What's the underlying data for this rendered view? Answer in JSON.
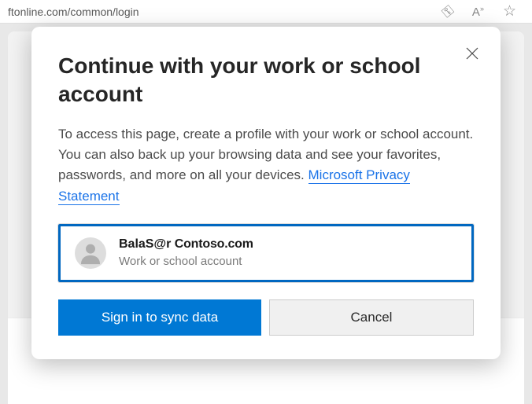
{
  "url_bar": {
    "text": "ftonline.com/common/login"
  },
  "dialog": {
    "title": "Continue with your work or school account",
    "body_text": "To access this page, create a profile with your work or school account. You can also back up your browsing data and see your favorites, passwords, and more on all your devices. ",
    "privacy_link_label": "Microsoft Privacy Statement",
    "account": {
      "email_prefix": "BalaS@r",
      "email_domain": "Contoso.com",
      "type_label": "Work or school account"
    },
    "buttons": {
      "primary": "Sign in to sync data",
      "secondary": "Cancel"
    }
  }
}
